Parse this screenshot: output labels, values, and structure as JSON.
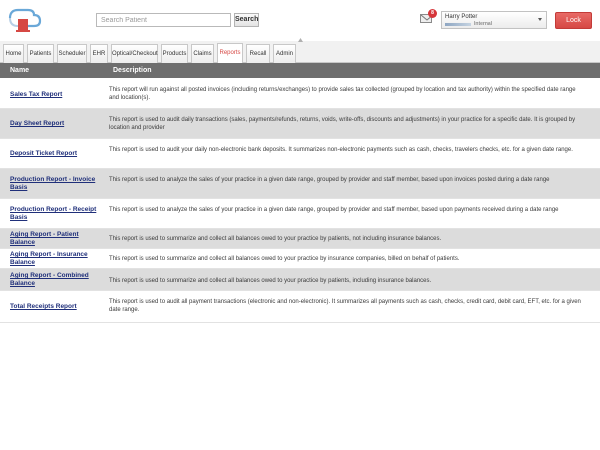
{
  "header": {
    "search": {
      "placeholder": "Search Patient",
      "button_label": "Search"
    },
    "mail": {
      "icon": "mail-icon",
      "badge_count": "8"
    },
    "user": {
      "name": "Harry Potter",
      "organization": "Internal"
    },
    "lock_label": "Lock",
    "colors": {
      "accent": "#d64844",
      "table_header": "#6e6e6e",
      "link": "#1f2f7a"
    }
  },
  "tabs": [
    {
      "label": "Home",
      "active": false
    },
    {
      "label": "Patients",
      "active": false
    },
    {
      "label": "Scheduler",
      "active": false
    },
    {
      "label": "EHR",
      "active": false
    },
    {
      "label": "Optical/Checkout",
      "active": false
    },
    {
      "label": "Products",
      "active": false
    },
    {
      "label": "Claims",
      "active": false
    },
    {
      "label": "Reports",
      "active": true
    },
    {
      "label": "Recall",
      "active": false
    },
    {
      "label": "Admin",
      "active": false
    }
  ],
  "table": {
    "headers": {
      "name": "Name",
      "description": "Description"
    },
    "rows": [
      {
        "name": "Sales Tax Report",
        "description": "This report will run against all posted invoices (including returns/exchanges) to provide sales tax collected (grouped by location and tax authority) within the specified date range and location(s)."
      },
      {
        "name": "Day Sheet Report",
        "description": "This report is used to audit daily transactions (sales, payments/refunds, returns, voids, write-offs, discounts and adjustments) in your practice for a specific date. It is grouped by location and provider"
      },
      {
        "name": "Deposit Ticket Report",
        "description": "This report is used to audit your daily non-electronic bank deposits. It summarizes non-electronic payments such as cash, checks, travelers checks, etc. for a given date range."
      },
      {
        "name": "Production Report - Invoice Basis",
        "description": "This report is used to analyze the sales of your practice in a given date range, grouped by provider and staff member, based upon invoices posted during a date range"
      },
      {
        "name": "Production Report - Receipt Basis",
        "description": "This report is used to analyze the sales of your practice in a given date range, grouped by provider and staff member, based upon payments received during a date range"
      },
      {
        "name": "Aging Report - Patient Balance",
        "description": "This report is used to summarize and collect all balances owed to your practice by patients, not including insurance balances."
      },
      {
        "name": "Aging Report - Insurance Balance",
        "description": "This report is used to summarize and collect all balances owed to your practice by insurance companies, billed on behalf of patients."
      },
      {
        "name": "Aging Report - Combined Balance",
        "description": "This report is used to summarize and collect all balances owed to your practice by patients, including insurance balances."
      },
      {
        "name": "Total Receipts Report",
        "description": "This report is used to audit all payment transactions (electronic and non-electronic). It summarizes all payments such as cash, checks, credit card, debit card, EFT, etc. for a given date range."
      }
    ]
  }
}
